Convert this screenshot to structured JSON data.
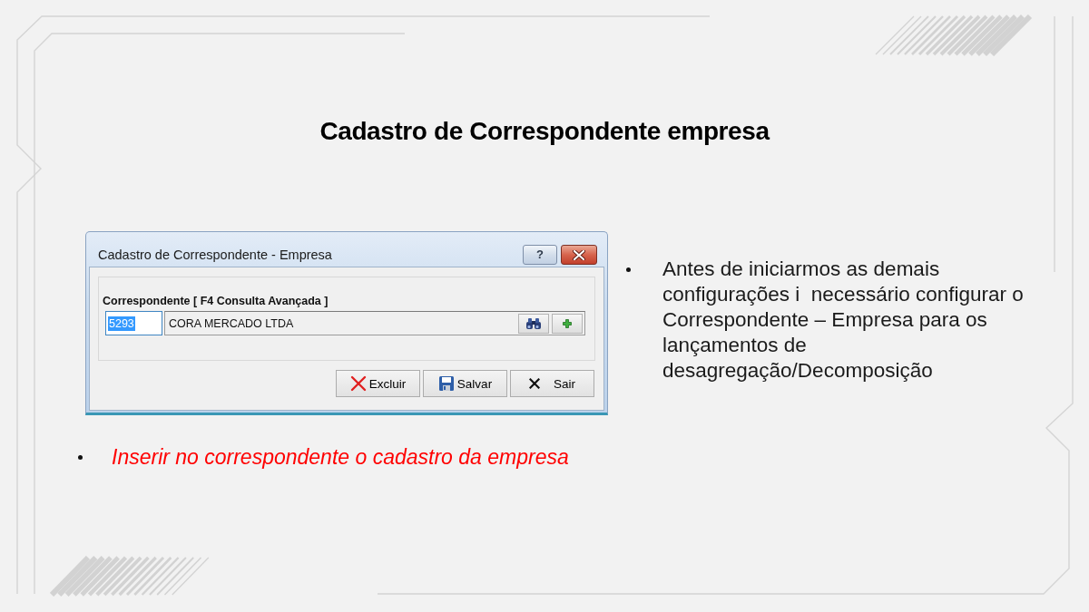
{
  "title": "Cadastro de Correspondente empresa",
  "dialog": {
    "title": "Cadastro de Correspondente - Empresa",
    "help_button": "?",
    "field_label": "Correspondente [ F4 Consulta Avançada ]",
    "code": {
      "value": "5293",
      "selected": true
    },
    "name": {
      "value": "CORA MERCADO LTDA"
    },
    "buttons": [
      {
        "kind": "delete",
        "label": "Excluir"
      },
      {
        "kind": "save",
        "label": "Salvar"
      },
      {
        "kind": "exit",
        "label": "Sair"
      }
    ]
  },
  "instruction": "Inserir no correspondente o cadastro da empresa",
  "note": "Antes de iniciarmos as demais configurações i  necessário configurar o Correspondente – Empresa para os lançamentos de desagregação/Decomposição"
}
